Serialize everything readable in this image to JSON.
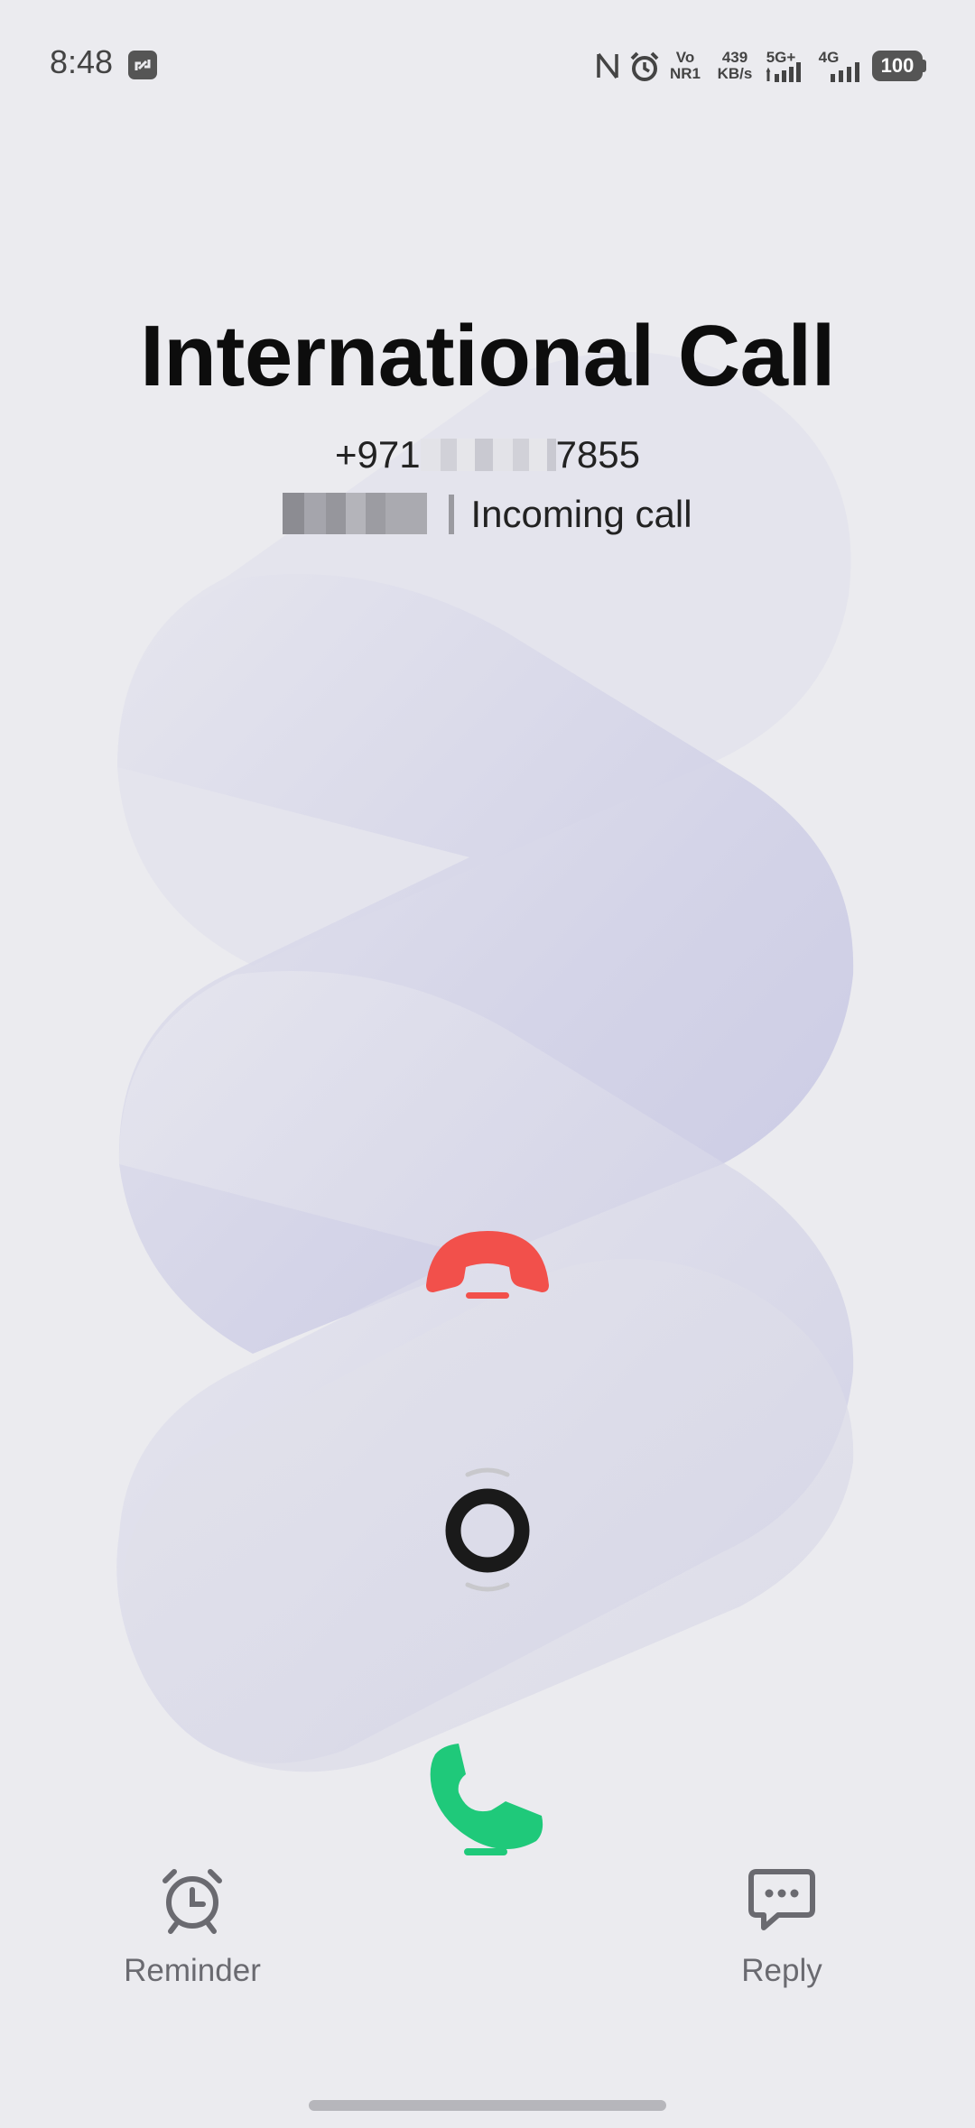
{
  "status_bar": {
    "time": "8:48",
    "vo_label": "Vo",
    "nr_label": "NR1",
    "speed_value": "439",
    "speed_unit": "KB/s",
    "network_5g": "5G+",
    "network_4g": "4G",
    "battery": "100",
    "icons": [
      "screenshot-app-icon",
      "nfc-icon",
      "alarm-icon",
      "signal-icon",
      "signal-icon",
      "battery-icon"
    ]
  },
  "caller": {
    "title": "International Call",
    "number_prefix": "+971",
    "number_suffix": "7855",
    "status_text": "Incoming call"
  },
  "controls": {
    "decline_color": "#f2504b",
    "answer_color": "#1fc97a",
    "knob_color": "#1a1a1a"
  },
  "actions": {
    "reminder_label": "Reminder",
    "reply_label": "Reply"
  }
}
